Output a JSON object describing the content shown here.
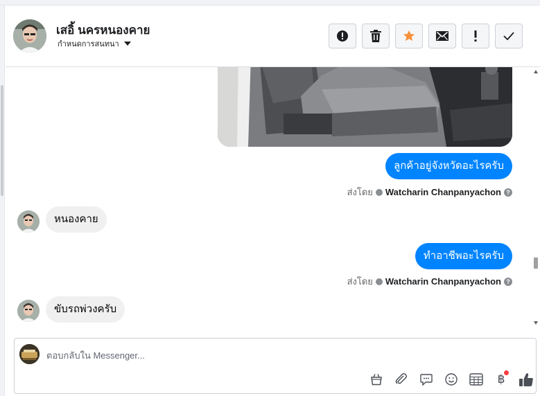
{
  "header": {
    "contact_name": "เสอิ้ นครหนองคาย",
    "chat_settings_label": "กำหนดการสนทนา",
    "actions": [
      {
        "name": "mark-spam-button",
        "icon": "exclamation-circle-icon"
      },
      {
        "name": "delete-button",
        "icon": "trash-icon"
      },
      {
        "name": "star-button",
        "icon": "star-icon"
      },
      {
        "name": "mark-unread-button",
        "icon": "envelope-icon"
      },
      {
        "name": "follow-up-button",
        "icon": "exclamation-icon"
      },
      {
        "name": "mark-done-button",
        "icon": "checkmark-icon"
      }
    ]
  },
  "messages": [
    {
      "direction": "outgoing",
      "type": "image",
      "description_icon": "car-seat-photo"
    },
    {
      "direction": "outgoing",
      "text": "ลูกค้าอยู่จังหวัดอะไรครับ"
    },
    {
      "type": "sent_by",
      "prefix": "ส่งโดย",
      "sender": "Watcharin Chanpanyachon",
      "help": "?"
    },
    {
      "direction": "incoming",
      "text": "หนองคาย"
    },
    {
      "direction": "outgoing",
      "text": "ทำอาชีพอะไรครับ"
    },
    {
      "type": "sent_by",
      "prefix": "ส่งโดย",
      "sender": "Watcharin Chanpanyachon",
      "help": "?"
    },
    {
      "direction": "incoming",
      "text": "ขับรถพ่วงครับ"
    }
  ],
  "composer": {
    "placeholder": "ตอบกลับใน Messenger...",
    "tools": [
      {
        "name": "shop-bag-icon"
      },
      {
        "name": "attachment-icon"
      },
      {
        "name": "saved-replies-icon"
      },
      {
        "name": "emoji-icon"
      },
      {
        "name": "appointment-icon"
      },
      {
        "name": "payment-icon",
        "glyph": "฿"
      },
      {
        "name": "like-icon"
      }
    ]
  },
  "colors": {
    "outgoing_bubble": "#0084ff",
    "incoming_bubble": "#f0f0f0",
    "star": "#f7923b",
    "notification_dot": "#fa3e3e"
  }
}
